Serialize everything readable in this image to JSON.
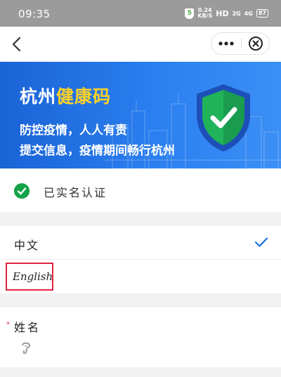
{
  "status_bar": {
    "time": "09:35",
    "shield": "5",
    "speed_value": "0.24",
    "speed_unit": "KB/S",
    "hd": "HD",
    "signal1": "2G",
    "signal2": "4G",
    "battery": "87"
  },
  "nav": {
    "back_icon": "chevron-left-icon",
    "more_icon": "more-dots-icon",
    "close_icon": "close-circle-icon"
  },
  "banner": {
    "title_city": "杭州",
    "title_highlight": "健康码",
    "line1": "防控疫情，人人有责",
    "line2": "提交信息，疫情期间畅行杭州",
    "colors": {
      "background": "#2b7ff0",
      "highlight": "#ffd326"
    }
  },
  "verify": {
    "text": "已实名认证",
    "color": "#16a34a"
  },
  "language": {
    "chinese_label": "中文",
    "english_label": "English",
    "selected": "中文",
    "check_color": "#1a73e8",
    "highlight_box_color": "#e02440"
  },
  "form": {
    "required_mark": "*",
    "name_label": "姓名"
  }
}
